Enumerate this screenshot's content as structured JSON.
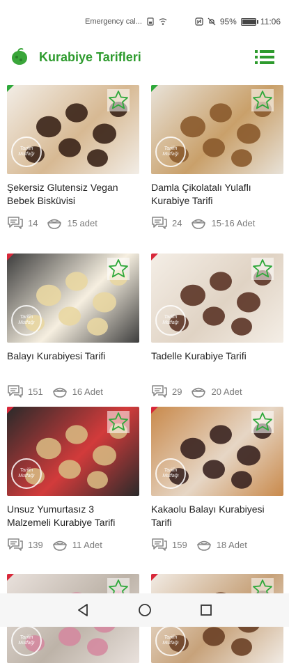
{
  "status_bar": {
    "carrier": "Emergency cal...",
    "battery": "95%",
    "time": "11:06",
    "battery_level": 0.95
  },
  "app_bar": {
    "title": "Kurabiye Tarifleri",
    "logo_icon": "cookie-logo-icon",
    "menu_icon": "list-menu-icon",
    "accent_color": "#2e9b2e"
  },
  "recipes": [
    {
      "title": "Şekersiz Glutensiz Vegan Bebek Bisküvisi",
      "comments": "14",
      "portions": "15 adet",
      "ribbon": "green",
      "image_colors": [
        "#f2ede6",
        "#3a2318",
        "#d7b993"
      ]
    },
    {
      "title": "Damla Çikolatalı Yulaflı Kurabiye Tarifi",
      "comments": "24",
      "portions": "15-16 Adet",
      "ribbon": "green",
      "image_colors": [
        "#e8e2d8",
        "#8a5a2c",
        "#c9a06a"
      ]
    },
    {
      "title": "Balayı Kurabiyesi Tarifi",
      "comments": "151",
      "portions": "16 Adet",
      "ribbon": "red",
      "image_colors": [
        "#3d3d3d",
        "#e9d7a2",
        "#f6efe0"
      ]
    },
    {
      "title": "Tadelle Kurabiye Tarifi",
      "comments": "29",
      "portions": "20 Adet",
      "ribbon": "red",
      "image_colors": [
        "#f4eee6",
        "#5b3426",
        "#e0d3c4"
      ]
    },
    {
      "title": "Unsuz Yumurtasız 3 Malzemeli Kurabiye Tarifi",
      "comments": "139",
      "portions": "11 Adet",
      "ribbon": "red",
      "image_colors": [
        "#2a2a2a",
        "#d6b680",
        "#d23b3b"
      ]
    },
    {
      "title": "Kakaolu Balayı Kurabiyesi Tarifi",
      "comments": "159",
      "portions": "18 Adet",
      "ribbon": "red",
      "image_colors": [
        "#c98a4c",
        "#3a2320",
        "#e6d6c5"
      ]
    },
    {
      "title": "",
      "comments": "",
      "portions": "",
      "ribbon": "red",
      "image_colors": [
        "#e9e1dc",
        "#d48aa0",
        "#bdb3a8"
      ]
    },
    {
      "title": "",
      "comments": "",
      "portions": "",
      "ribbon": "red",
      "image_colors": [
        "#f1ebe4",
        "#6a4026",
        "#c7a27a"
      ]
    }
  ],
  "watermark_text": "Tarifin Mutfağı",
  "nav": {
    "back_icon": "back-triangle-icon",
    "home_icon": "home-circle-icon",
    "recents_icon": "recents-square-icon"
  }
}
